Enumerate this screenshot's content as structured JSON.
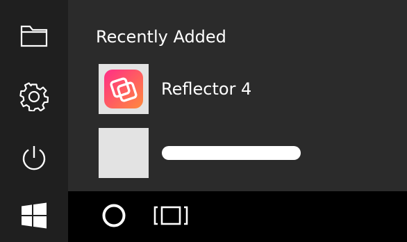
{
  "start_menu": {
    "section_title": "Recently Added",
    "apps": [
      {
        "label": "Reflector 4",
        "icon": "reflector-icon"
      },
      {
        "label": "",
        "icon": "placeholder-tile"
      }
    ]
  },
  "rail": {
    "items": [
      {
        "icon": "folder-icon"
      },
      {
        "icon": "gear-icon"
      },
      {
        "icon": "power-icon"
      }
    ]
  },
  "taskbar": {
    "start_icon": "windows-logo-icon",
    "search_icon": "cortana-circle-icon",
    "task_view_icon": "task-view-icon"
  },
  "colors": {
    "menu_background": "#2b2b2b",
    "rail_background": "#1f1f1f",
    "taskbar_background": "#000000",
    "tile_placeholder": "#e3e3e3",
    "reflector_gradient_start": "#ff2d87",
    "reflector_gradient_end": "#ff8a3d"
  }
}
